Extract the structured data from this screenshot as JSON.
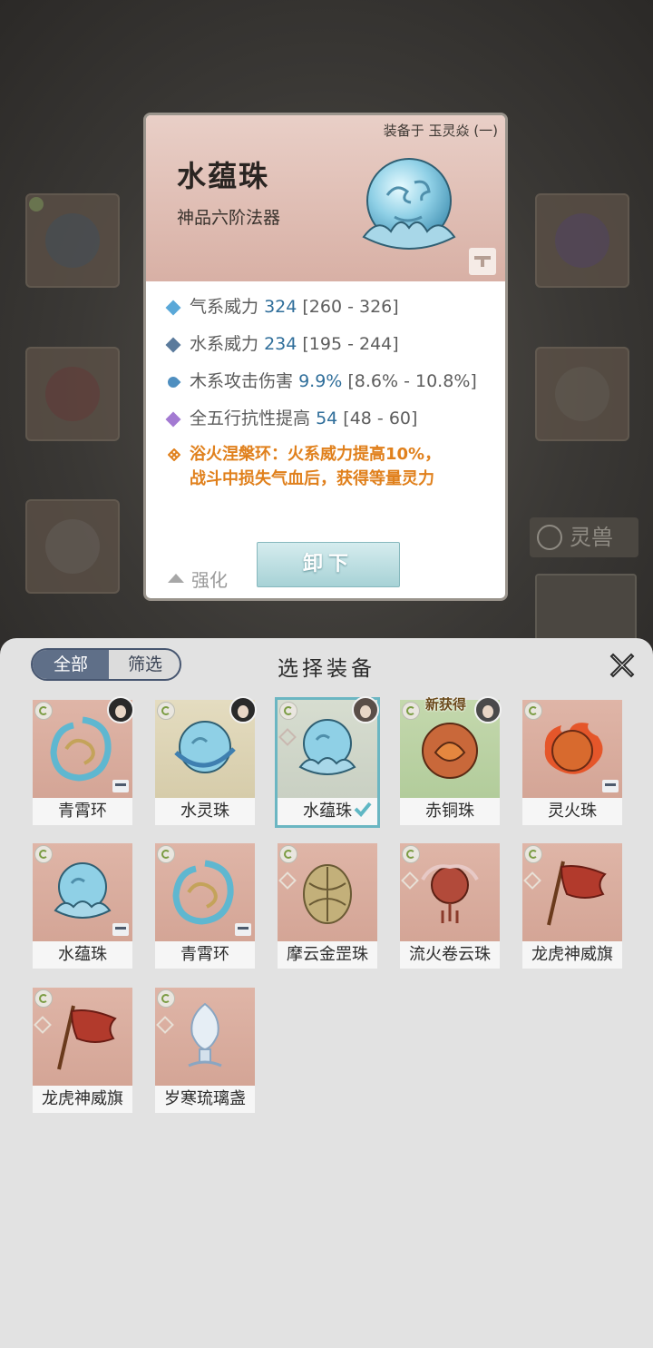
{
  "detail": {
    "equipped_on": "装备于 玉灵焱 (一)",
    "name": "水蕴珠",
    "grade": "神品六阶法器",
    "stats": [
      {
        "name": "气系威力",
        "value": "324",
        "range": "[260 - 326]",
        "icon_color": "#5aa8d8"
      },
      {
        "name": "水系威力",
        "value": "234",
        "range": "[195 - 244]",
        "icon_color": "#5a7a9c"
      },
      {
        "name": "木系攻击伤害",
        "value": "9.9%",
        "range": "[8.6% - 10.8%]",
        "icon_color": "#4f8fc0"
      },
      {
        "name": "全五行抗性提高",
        "value": "54",
        "range": "[48 - 60]",
        "icon_color": "#a37ad2"
      }
    ],
    "special_line1": "浴火涅槃环：火系威力提高10%，",
    "special_line2": "战斗中损失气血后，获得等量灵力",
    "enhance_label": "强化",
    "unload_label": "卸下"
  },
  "background": {
    "beast_label": "灵兽"
  },
  "panel": {
    "title": "选择装备",
    "tab_all": "全部",
    "tab_filter": "筛选",
    "new_tag": "新获得",
    "items": [
      {
        "name": "青霄环",
        "type": "ring"
      },
      {
        "name": "水灵珠",
        "type": "orb"
      },
      {
        "name": "水蕴珠",
        "type": "orb",
        "selected": true
      },
      {
        "name": "赤铜珠",
        "type": "bronze",
        "new": true
      },
      {
        "name": "灵火珠",
        "type": "fire"
      },
      {
        "name": "水蕴珠",
        "type": "orb"
      },
      {
        "name": "青霄环",
        "type": "ring"
      },
      {
        "name": "摩云金罡珠",
        "type": "gold"
      },
      {
        "name": "流火卷云珠",
        "type": "cloud"
      },
      {
        "name": "龙虎神威旗",
        "type": "flag"
      },
      {
        "name": "龙虎神威旗",
        "type": "flag"
      },
      {
        "name": "岁寒琉璃盏",
        "type": "ice"
      }
    ]
  },
  "colors": {
    "accent_teal": "#6bb6c2",
    "special_orange": "#e0801c",
    "stat_blue": "#2f6e9a"
  }
}
